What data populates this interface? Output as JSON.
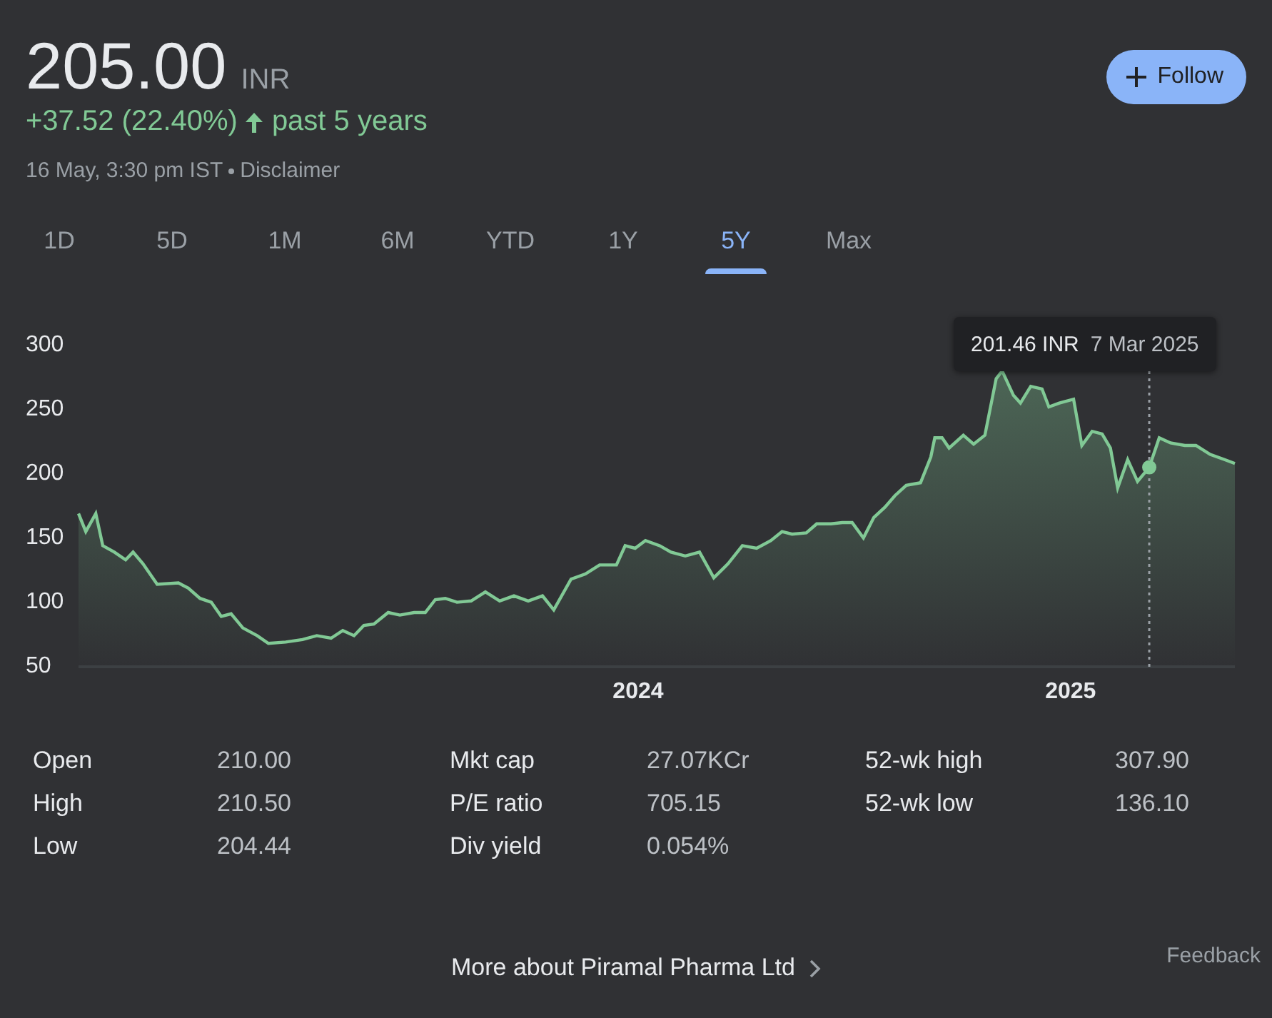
{
  "quote": {
    "price": "205.00",
    "currency": "INR",
    "change": "+37.52 (22.40%)",
    "period": "past 5 years",
    "timestamp": "16 May, 3:30 pm IST",
    "disclaimer": "Disclaimer"
  },
  "follow_button": {
    "label": "Follow"
  },
  "tabs": [
    {
      "label": "1D",
      "selected": false
    },
    {
      "label": "5D",
      "selected": false
    },
    {
      "label": "1M",
      "selected": false
    },
    {
      "label": "6M",
      "selected": false
    },
    {
      "label": "YTD",
      "selected": false
    },
    {
      "label": "1Y",
      "selected": false
    },
    {
      "label": "5Y",
      "selected": true
    },
    {
      "label": "Max",
      "selected": false
    }
  ],
  "chart": {
    "tooltip": {
      "price": "201.46 INR",
      "date": "7 Mar 2025"
    },
    "chart_data": {
      "type": "area",
      "xlim": [
        2022.706,
        2025.38
      ],
      "ylim": [
        50,
        300
      ],
      "yticks": [
        50,
        100,
        150,
        200,
        250,
        300
      ],
      "xticks": [
        {
          "value": 2024,
          "label": "2024"
        },
        {
          "value": 2025,
          "label": "2025"
        }
      ],
      "ref_lines": [
        {
          "axis": "x",
          "value": 2025.182
        }
      ],
      "x": [
        2022.706,
        2022.723,
        2022.746,
        2022.762,
        2022.789,
        2022.815,
        2022.832,
        2022.855,
        2022.888,
        2022.937,
        2022.96,
        2022.987,
        2023.013,
        2023.036,
        2023.059,
        2023.086,
        2023.119,
        2023.145,
        2023.185,
        2023.224,
        2023.257,
        2023.29,
        2023.317,
        2023.343,
        2023.366,
        2023.389,
        2023.422,
        2023.449,
        2023.482,
        2023.508,
        2023.531,
        2023.554,
        2023.581,
        2023.614,
        2023.647,
        2023.68,
        2023.713,
        2023.746,
        2023.779,
        2023.805,
        2023.845,
        2023.878,
        2023.911,
        2023.95,
        2023.97,
        2023.993,
        2024.017,
        2024.05,
        2024.076,
        2024.109,
        2024.142,
        2024.175,
        2024.208,
        2024.241,
        2024.274,
        2024.307,
        2024.333,
        2024.356,
        2024.389,
        2024.413,
        2024.446,
        2024.472,
        2024.495,
        2024.521,
        2024.545,
        2024.571,
        2024.594,
        2024.62,
        2024.653,
        2024.677,
        2024.686,
        2024.703,
        2024.719,
        2024.752,
        2024.776,
        2024.802,
        2024.828,
        2024.842,
        2024.868,
        2024.884,
        2024.908,
        2024.934,
        2024.95,
        2024.974,
        2025.007,
        2025.026,
        2025.05,
        2025.073,
        2025.092,
        2025.109,
        2025.132,
        2025.155,
        2025.182,
        2025.205,
        2025.231,
        2025.264,
        2025.29,
        2025.323,
        2025.356,
        2025.38
      ],
      "series": [
        {
          "color": "#81c995",
          "values": [
            167,
            153,
            167,
            142,
            137,
            131,
            137,
            128,
            112,
            113,
            109,
            101,
            98,
            87,
            89,
            78,
            72,
            66,
            67,
            69,
            72,
            70,
            76,
            72,
            80,
            81,
            90,
            88,
            90,
            90,
            100,
            101,
            98,
            99,
            106,
            99,
            103,
            99,
            103,
            92,
            116,
            120,
            127,
            127,
            142,
            140,
            146,
            142,
            137,
            134,
            137,
            117,
            128,
            142,
            140,
            146,
            153,
            151,
            152,
            159,
            159,
            160,
            160,
            148,
            164,
            172,
            181,
            189,
            191,
            211,
            226,
            226,
            218,
            228,
            221,
            228,
            272,
            278,
            259,
            253,
            266,
            264,
            250,
            253,
            256,
            220,
            231,
            229,
            218,
            187,
            209,
            192,
            203,
            226,
            222,
            220,
            220,
            213,
            209,
            206
          ]
        }
      ]
    }
  },
  "stats": [
    {
      "label": "Open",
      "value": "210.00"
    },
    {
      "label": "Mkt cap",
      "value": "27.07KCr"
    },
    {
      "label": "52-wk high",
      "value": "307.90"
    },
    {
      "label": "High",
      "value": "210.50"
    },
    {
      "label": "P/E ratio",
      "value": "705.15"
    },
    {
      "label": "52-wk low",
      "value": "136.10"
    },
    {
      "label": "Low",
      "value": "204.44"
    },
    {
      "label": "Div yield",
      "value": "0.054%"
    }
  ],
  "more_link": "More about Piramal Pharma Ltd",
  "feedback": "Feedback"
}
